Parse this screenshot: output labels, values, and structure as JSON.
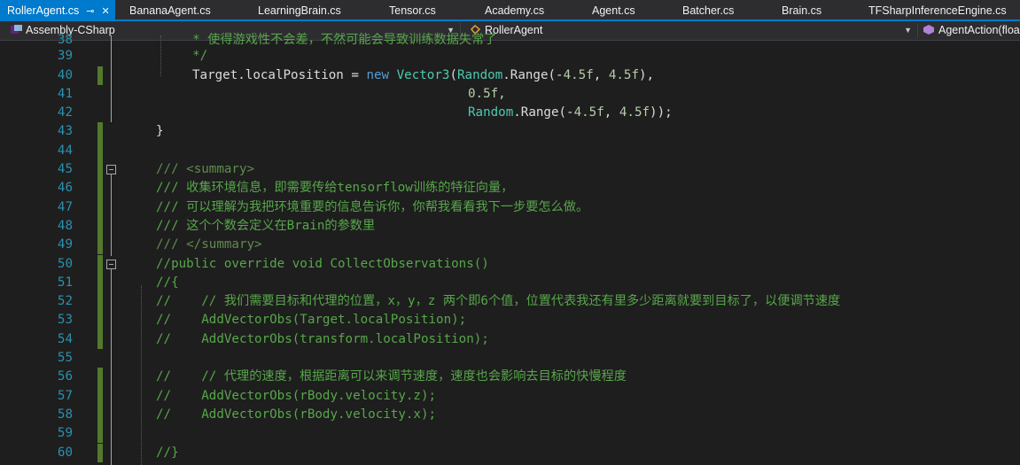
{
  "tabs": [
    {
      "label": "RollerAgent.cs",
      "active": true
    },
    {
      "label": "BananaAgent.cs"
    },
    {
      "label": "LearningBrain.cs"
    },
    {
      "label": "Tensor.cs"
    },
    {
      "label": "Academy.cs"
    },
    {
      "label": "Agent.cs"
    },
    {
      "label": "Batcher.cs"
    },
    {
      "label": "Brain.cs"
    },
    {
      "label": "TFSharpInferenceEngine.cs"
    }
  ],
  "tab_icons": {
    "pin": "pin-icon",
    "close": "close-icon"
  },
  "navbar": {
    "project": "Assembly-CSharp",
    "class": "RollerAgent",
    "member": "AgentAction(floa"
  },
  "colors": {
    "accent": "#007acc",
    "background": "#1e1e1e",
    "line_number": "#2b91af",
    "comment": "#57a64a",
    "keyword": "#569cd6",
    "type": "#4ec9b0",
    "number": "#b5cea8",
    "change_marker": "#537a2c"
  },
  "lines": [
    {
      "num": "38",
      "text": "  * 使得游戏性不会差，不然可能会导致训练数据失常了"
    },
    {
      "num": "39",
      "text": "  */"
    },
    {
      "num": "40",
      "text": "Target.localPosition = new Vector3(Random.Range(-4.5f, 4.5f),"
    },
    {
      "num": "41",
      "text": "0.5f,"
    },
    {
      "num": "42",
      "text": "Random.Range(-4.5f, 4.5f));"
    },
    {
      "num": "43",
      "text": "}"
    },
    {
      "num": "44",
      "text": ""
    },
    {
      "num": "45",
      "text": "/// <summary>"
    },
    {
      "num": "46",
      "text": "/// 收集环境信息，即需要传给tensorflow训练的特征向量，"
    },
    {
      "num": "47",
      "text": "/// 可以理解为我把环境重要的信息告诉你，你帮我看看我下一步要怎么做。"
    },
    {
      "num": "48",
      "text": "/// 这个个数会定义在Brain的参数里"
    },
    {
      "num": "49",
      "text": "/// </summary>"
    },
    {
      "num": "50",
      "text": "//public override void CollectObservations()"
    },
    {
      "num": "51",
      "text": "//{"
    },
    {
      "num": "52",
      "text": "//    // 我们需要目标和代理的位置，x，y，z 两个即6个值，位置代表我还有里多少距离就要到目标了，以便调节速度"
    },
    {
      "num": "53",
      "text": "//    AddVectorObs(Target.localPosition);"
    },
    {
      "num": "54",
      "text": "//    AddVectorObs(transform.localPosition);"
    },
    {
      "num": "55",
      "text": ""
    },
    {
      "num": "56",
      "text": "//    // 代理的速度，根据距离可以来调节速度，速度也会影响去目标的快慢程度"
    },
    {
      "num": "57",
      "text": "//    AddVectorObs(rBody.velocity.z);"
    },
    {
      "num": "58",
      "text": "//    AddVectorObs(rBody.velocity.x);"
    },
    {
      "num": "59",
      "text": ""
    },
    {
      "num": "60",
      "text": "//}"
    }
  ]
}
